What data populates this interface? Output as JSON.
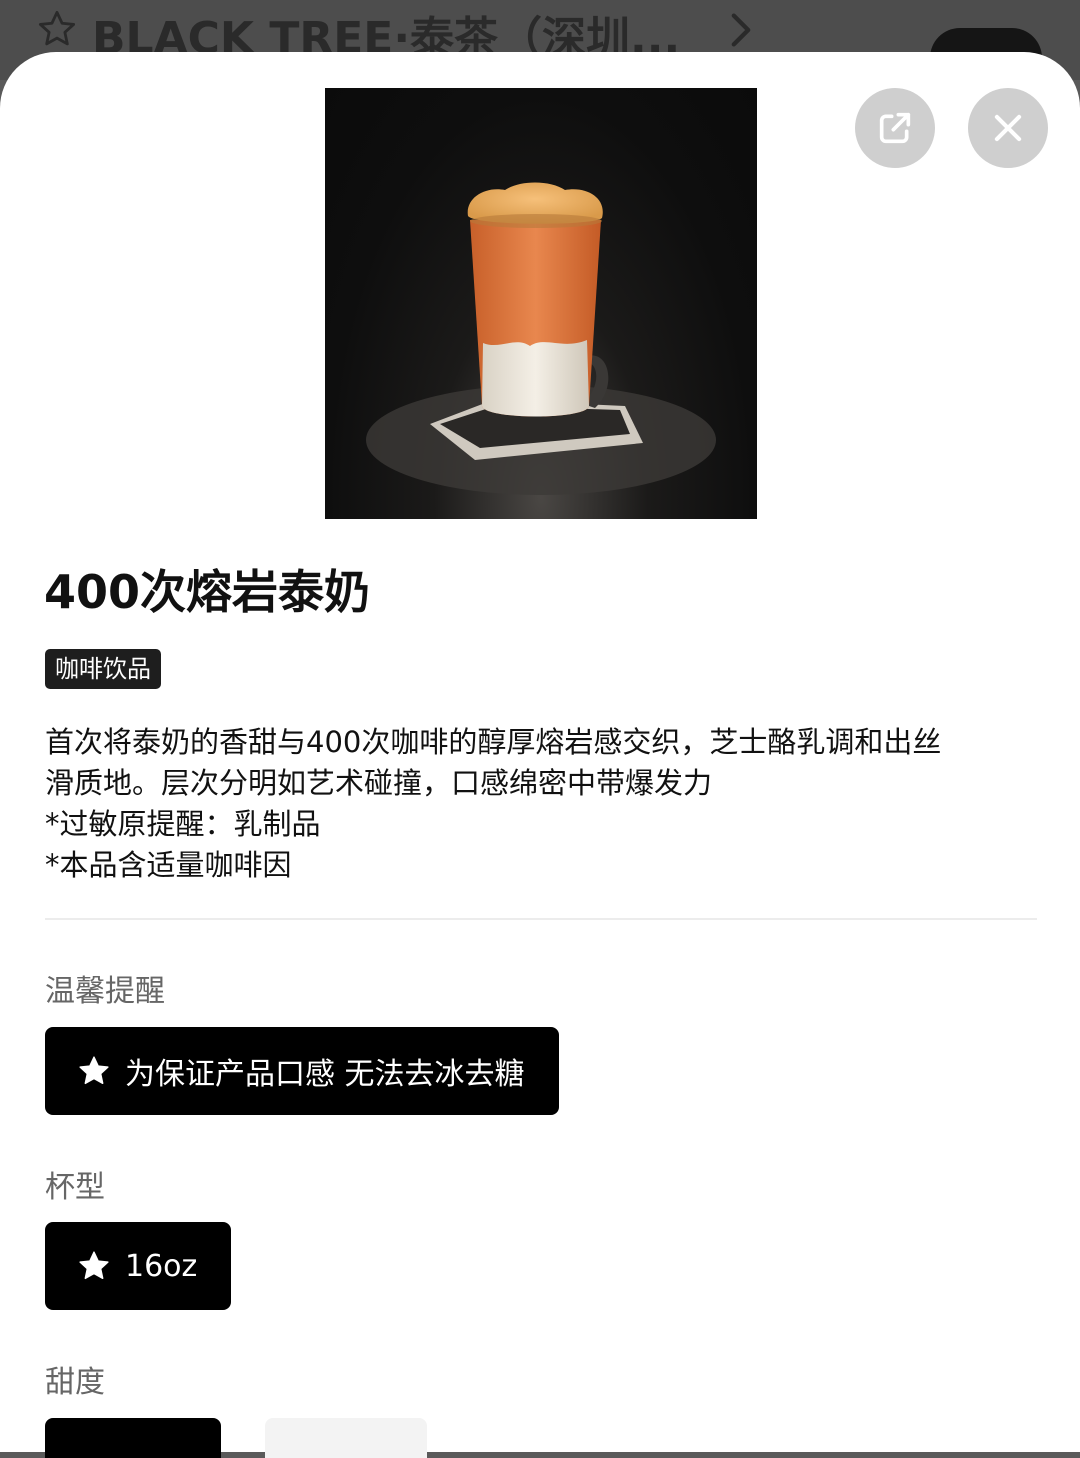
{
  "background": {
    "shop_title": "BLACK TREE·泰茶（深圳...",
    "favorite_icon": "star-outline-icon",
    "chevron_icon": "chevron-right-icon"
  },
  "header_actions": {
    "share_icon": "share-icon",
    "close_icon": "close-icon"
  },
  "product": {
    "name": "400次熔岩泰奶",
    "category": "咖啡饮品",
    "description_lines": [
      "首次将泰奶的香甜与400次咖啡的醇厚熔岩感交织，芝士酪乳调和出丝",
      "滑质地。层次分明如艺术碰撞，口感绵密中带爆发力",
      "*过敏原提醒：乳制品",
      "*本品含适量咖啡因"
    ]
  },
  "sections": {
    "notice": {
      "label": "温馨提醒",
      "option": "为保证产品口感 无法去冰去糖"
    },
    "cup": {
      "label": "杯型",
      "option": "16oz"
    },
    "sweetness": {
      "label": "甜度"
    }
  },
  "colors": {
    "selected_bg": "#000000",
    "tag_bg": "#1e1e1e",
    "secondary_text": "#666666",
    "unselected_bg": "#f3f3f3"
  }
}
